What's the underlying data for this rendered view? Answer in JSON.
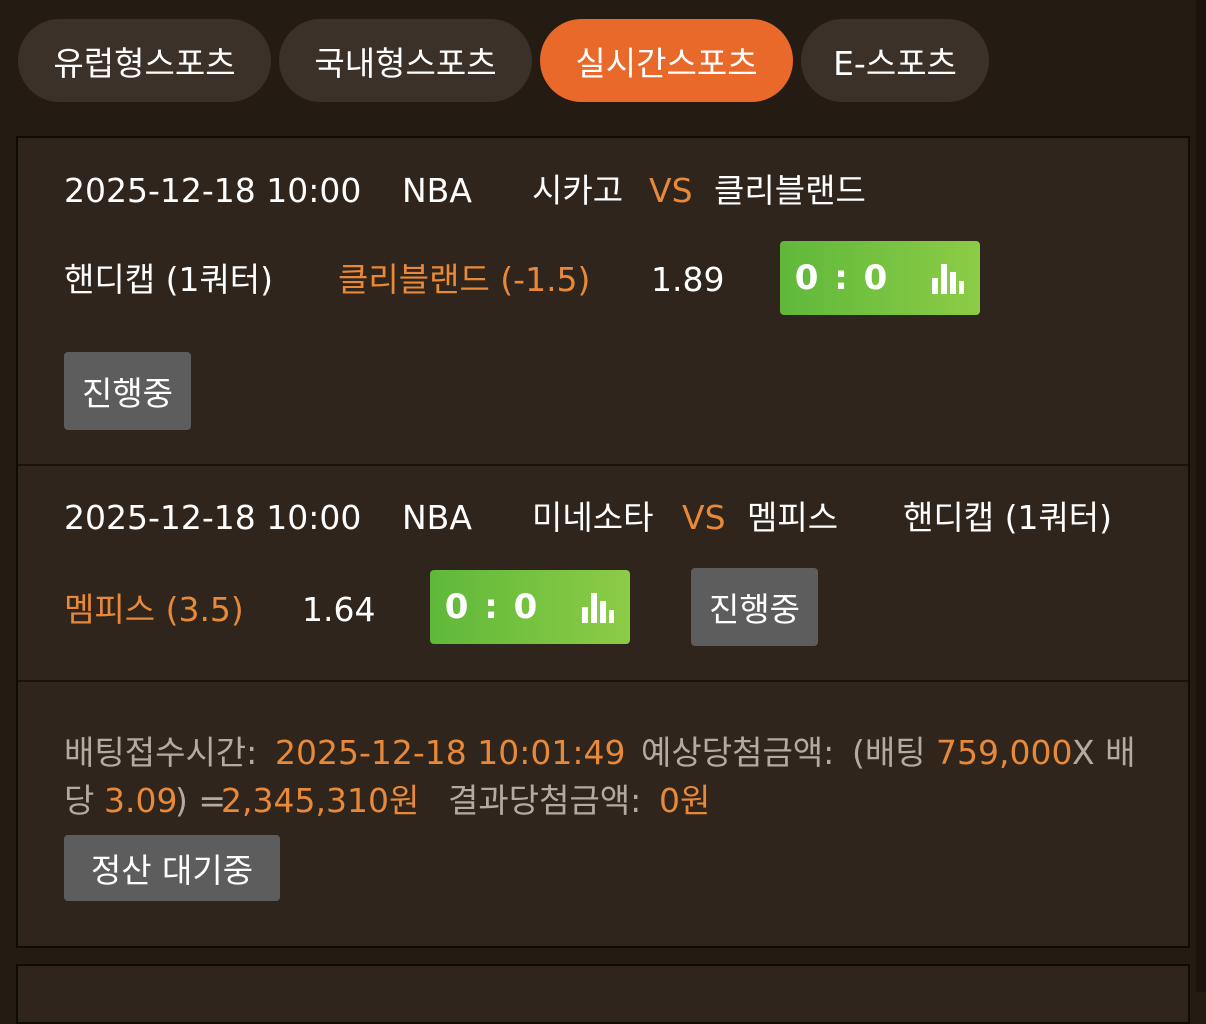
{
  "tabs": [
    {
      "label": "유럽형스포츠",
      "active": false
    },
    {
      "label": "국내형스포츠",
      "active": false
    },
    {
      "label": "실시간스포츠",
      "active": true
    },
    {
      "label": "E-스포츠",
      "active": false
    }
  ],
  "colors": {
    "background": "#241b12",
    "card": "#2f251c",
    "accent": "#e8692a",
    "highlight_text": "#e8893a",
    "score_green": "#7cc242",
    "status_grey": "#5d5d5d"
  },
  "bets": [
    {
      "datetime": "2025-12-18 10:00",
      "league": "NBA",
      "home": "시카고",
      "vs": "VS",
      "away": "클리블랜드",
      "market": "핸디캡 (1쿼터)",
      "pick": "클리블랜드 (-1.5)",
      "odds": "1.89",
      "score": "0 : 0",
      "score_icon": "bar-chart-icon",
      "status": "진행중"
    },
    {
      "datetime": "2025-12-18 10:00",
      "league": "NBA",
      "home": "미네소타",
      "vs": "VS",
      "away": "멤피스",
      "market": "핸디캡 (1쿼터)",
      "pick": "멤피스 (3.5)",
      "odds": "1.64",
      "score": "0 : 0",
      "score_icon": "bar-chart-icon",
      "status": "진행중"
    }
  ],
  "summary": {
    "time_label": "배팅접수시간:",
    "time_value": "2025-12-18 10:01:49",
    "expected_label": "예상당첨금액:",
    "expected_open": "(배팅",
    "bet_amount": "759,000",
    "x_label": "X 배",
    "line2_prefix": "당",
    "total_odds": "3.09",
    "close_eq": ") =",
    "expected_amount": "2,345,310원",
    "result_label": "결과당첨금액:",
    "result_amount": "0원",
    "settle_status": "정산 대기중"
  }
}
